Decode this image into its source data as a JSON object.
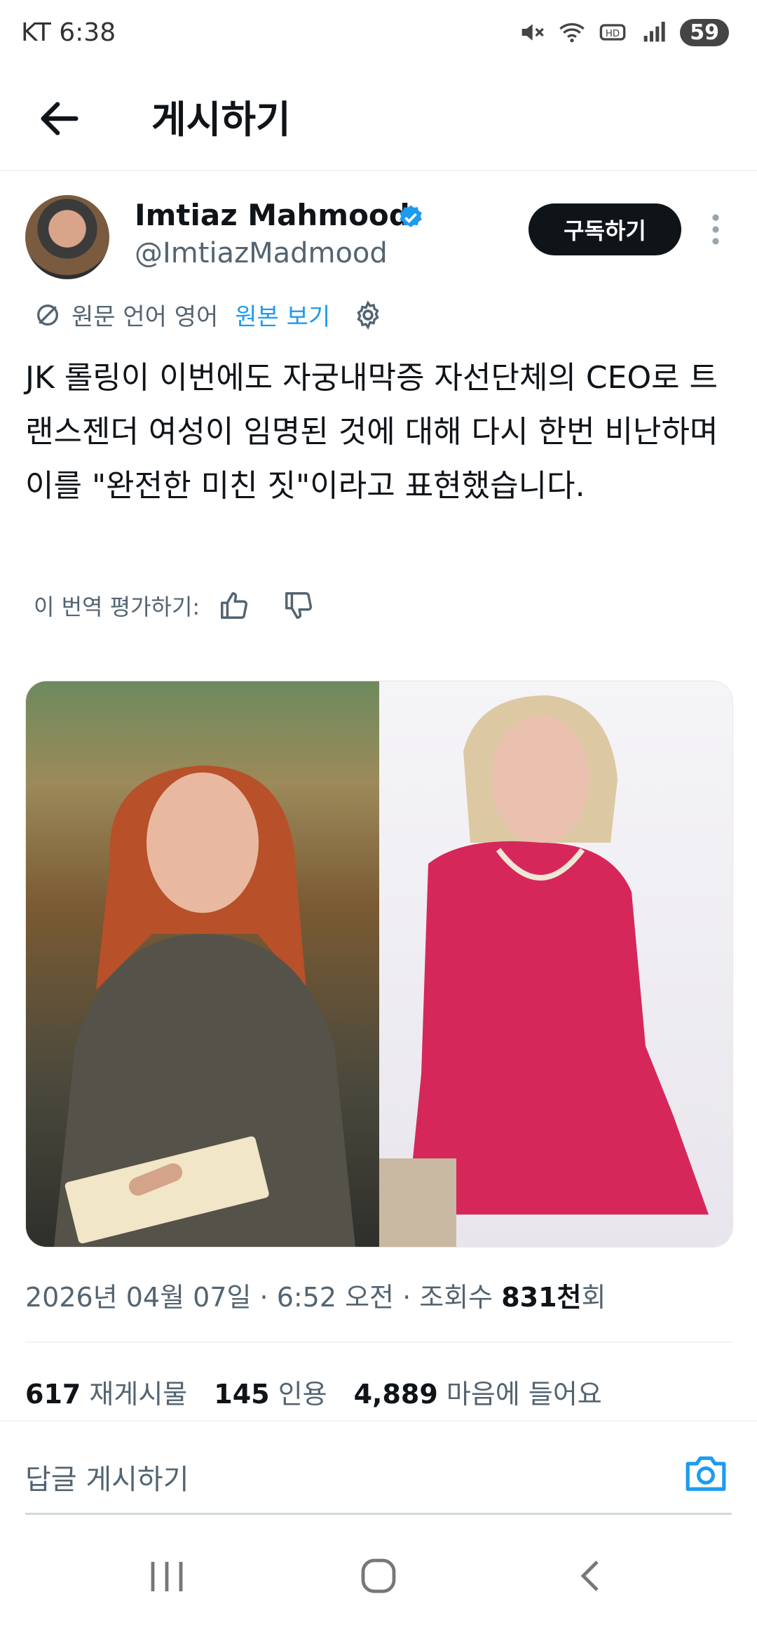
{
  "status_bar": {
    "carrier": "KT",
    "time": "6:38",
    "battery": "59"
  },
  "header": {
    "title": "게시하기"
  },
  "author": {
    "name": "Imtiaz Mahmood",
    "handle": "@ImtiazMadmood"
  },
  "subscribe_label": "구독하기",
  "translation": {
    "original_language": "원문 언어 영어",
    "view_original": "원본 보기"
  },
  "post_text": "JK 롤링이 이번에도 자궁내막증 자선단체의 CEO로 트랜스젠더 여성이 임명된 것에 대해 다시 한번 비난하며 이를 \"완전한 미친 짓\"이라고 표현했습니다.",
  "rate_translation": "이 번역 평가하기:",
  "meta": {
    "date_time": "2026년 04월 07일 · 6:52 오전 · 조회수 ",
    "views": "831천",
    "views_suffix": "회"
  },
  "stats": {
    "reposts_count": "617",
    "reposts_label": "재게시물",
    "quotes_count": "145",
    "quotes_label": "인용",
    "likes_count": "4,889",
    "likes_label": "마음에 들어요"
  },
  "reply_placeholder": "답글 게시하기",
  "colors": {
    "accent": "#1d9bf0",
    "text": "#0f1419",
    "muted": "#536471"
  }
}
